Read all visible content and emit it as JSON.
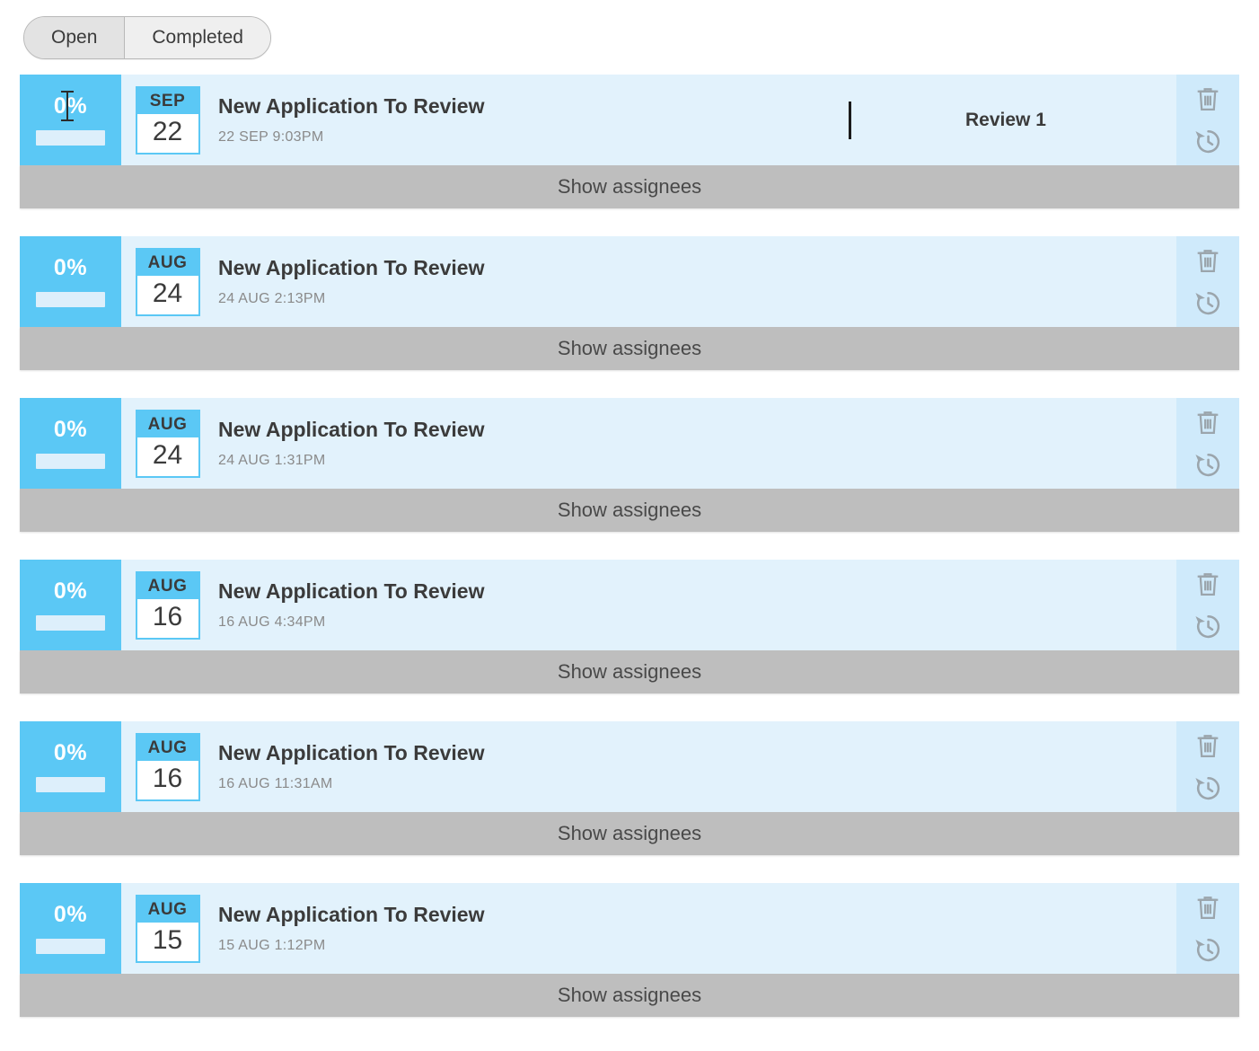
{
  "filter_toggle": {
    "options": [
      {
        "label": "Open",
        "selected": true
      },
      {
        "label": "Completed",
        "selected": false
      }
    ]
  },
  "colors": {
    "accent_blue": "#5bc8f5",
    "row_background": "#e2f2fc",
    "action_column": "#cfeafb",
    "assignees_bar": "#bebebe",
    "progress_track": "#ddeffb"
  },
  "assignees_bar_label": "Show assignees",
  "icons": {
    "delete": "trash-icon",
    "history": "history-icon"
  },
  "tasks": [
    {
      "progress": "0%",
      "progress_value": 0,
      "month": "SEP",
      "day": "22",
      "title": "New Application To Review",
      "timestamp": "22 SEP 9:03PM",
      "assignees_label": "Show assignees",
      "editing": true,
      "review_label": "Review 1"
    },
    {
      "progress": "0%",
      "progress_value": 0,
      "month": "AUG",
      "day": "24",
      "title": "New Application To Review",
      "timestamp": "24 AUG 2:13PM",
      "assignees_label": "Show assignees",
      "editing": false,
      "review_label": ""
    },
    {
      "progress": "0%",
      "progress_value": 0,
      "month": "AUG",
      "day": "24",
      "title": "New Application To Review",
      "timestamp": "24 AUG 1:31PM",
      "assignees_label": "Show assignees",
      "editing": false,
      "review_label": ""
    },
    {
      "progress": "0%",
      "progress_value": 0,
      "month": "AUG",
      "day": "16",
      "title": "New Application To Review",
      "timestamp": "16 AUG 4:34PM",
      "assignees_label": "Show assignees",
      "editing": false,
      "review_label": ""
    },
    {
      "progress": "0%",
      "progress_value": 0,
      "month": "AUG",
      "day": "16",
      "title": "New Application To Review",
      "timestamp": "16 AUG 11:31AM",
      "assignees_label": "Show assignees",
      "editing": false,
      "review_label": ""
    },
    {
      "progress": "0%",
      "progress_value": 0,
      "month": "AUG",
      "day": "15",
      "title": "New Application To Review",
      "timestamp": "15 AUG 1:12PM",
      "assignees_label": "Show assignees",
      "editing": false,
      "review_label": ""
    }
  ]
}
